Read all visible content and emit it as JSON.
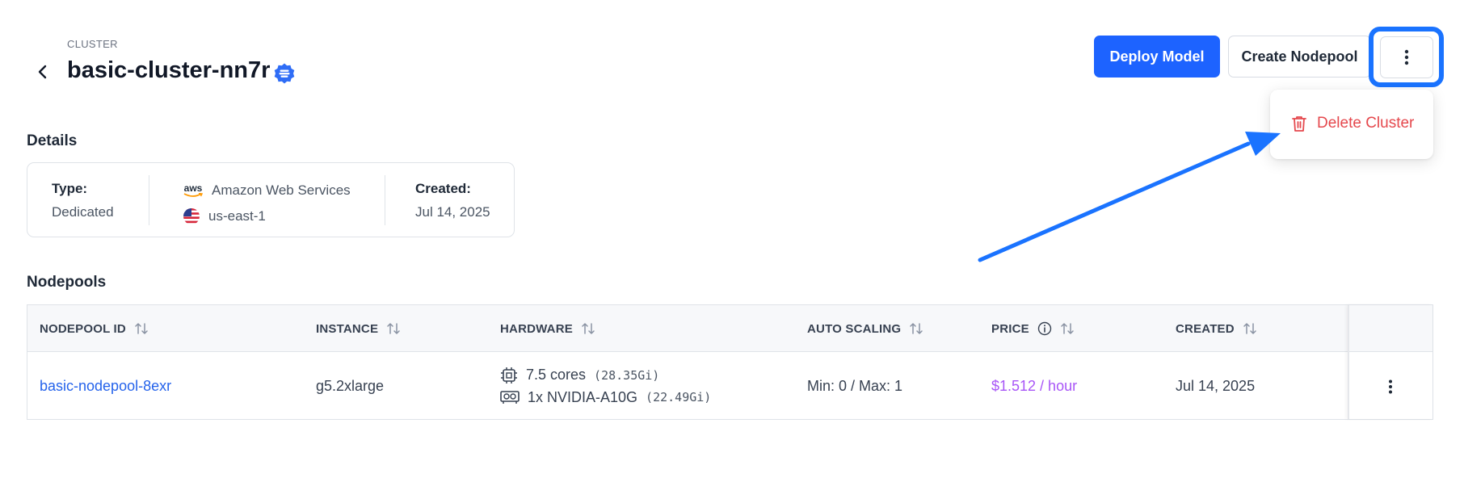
{
  "header": {
    "eyebrow": "CLUSTER",
    "title": "basic-cluster-nn7r",
    "deploy_label": "Deploy Model",
    "create_nodepool_label": "Create Nodepool"
  },
  "more_menu": {
    "delete_label": "Delete Cluster"
  },
  "details": {
    "section_title": "Details",
    "type_label": "Type:",
    "type_value": "Dedicated",
    "provider_logo_text": "aws",
    "provider": "Amazon Web Services",
    "region": "us-east-1",
    "created_label": "Created:",
    "created_value": "Jul 14, 2025"
  },
  "nodepools": {
    "section_title": "Nodepools",
    "columns": [
      "NODEPOOL ID",
      "INSTANCE",
      "HARDWARE",
      "AUTO SCALING",
      "PRICE",
      "CREATED"
    ],
    "rows": [
      {
        "id": "basic-nodepool-8exr",
        "instance": "g5.2xlarge",
        "cpu": "7.5 cores",
        "memory": "(28.35Gi)",
        "gpu": "1x NVIDIA-A10G",
        "gpu_memory": "(22.49Gi)",
        "auto_scaling": "Min: 0 / Max: 1",
        "price": "$1.512 / hour",
        "created": "Jul 14, 2025"
      }
    ]
  },
  "colors": {
    "primary": "#1d63ff",
    "highlight": "#1a73ff",
    "danger": "#e5484d",
    "link": "#2563eb",
    "price": "#a855f7"
  },
  "icons": {
    "back": "chevron-left-icon",
    "verified": "verified-badge-icon",
    "more": "more-vertical-icon",
    "delete": "trash-icon",
    "sort": "sort-icon",
    "info": "info-icon",
    "cpu": "cpu-icon",
    "gpu": "gpu-icon",
    "flag": "us-flag-icon",
    "aws": "aws-logo-icon"
  }
}
